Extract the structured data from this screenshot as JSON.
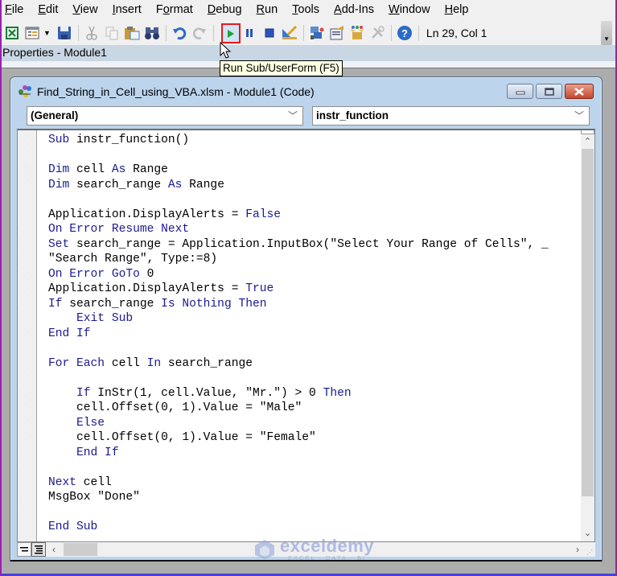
{
  "menu": [
    {
      "label": "File",
      "accel": "F",
      "rest": "ile"
    },
    {
      "label": "Edit",
      "accel": "E",
      "rest": "dit"
    },
    {
      "label": "View",
      "accel": "V",
      "rest": "iew"
    },
    {
      "label": "Insert",
      "accel": "I",
      "rest": "nsert"
    },
    {
      "label": "Format",
      "pre": "F",
      "accel": "o",
      "rest": "rmat"
    },
    {
      "label": "Debug",
      "accel": "D",
      "rest": "ebug"
    },
    {
      "label": "Run",
      "accel": "R",
      "rest": "un"
    },
    {
      "label": "Tools",
      "accel": "T",
      "rest": "ools"
    },
    {
      "label": "Add-Ins",
      "accel": "A",
      "rest": "dd-Ins"
    },
    {
      "label": "Window",
      "accel": "W",
      "rest": "indow"
    },
    {
      "label": "Help",
      "accel": "H",
      "rest": "elp"
    }
  ],
  "toolbar": {
    "status": "Ln 29, Col 1",
    "tooltip": "Run Sub/UserForm (F5)",
    "highlight_color": "#e41b1b"
  },
  "properties_title": "Properties - Module1",
  "code_window": {
    "title": "Find_String_in_Cell_using_VBA.xlsm - Module1 (Code)",
    "object_combo": "(General)",
    "procedure_combo": "instr_function",
    "keyword_color": "#1a1a8e",
    "lines": [
      [
        {
          "t": "Sub",
          "k": 1
        },
        {
          "t": " instr_function()"
        }
      ],
      [],
      [
        {
          "t": "Dim",
          "k": 1
        },
        {
          "t": " cell "
        },
        {
          "t": "As",
          "k": 1
        },
        {
          "t": " Range"
        }
      ],
      [
        {
          "t": "Dim",
          "k": 1
        },
        {
          "t": " search_range "
        },
        {
          "t": "As",
          "k": 1
        },
        {
          "t": " Range"
        }
      ],
      [],
      [
        {
          "t": "Application.DisplayAlerts = "
        },
        {
          "t": "False",
          "k": 1
        }
      ],
      [
        {
          "t": "On Error Resume Next",
          "k": 1
        }
      ],
      [
        {
          "t": "Set",
          "k": 1
        },
        {
          "t": " search_range = Application.InputBox(\"Select Your Range of Cells\", _"
        }
      ],
      [
        {
          "t": "\"Search Range\", Type:=8)"
        }
      ],
      [
        {
          "t": "On Error GoTo",
          "k": 1
        },
        {
          "t": " 0"
        }
      ],
      [
        {
          "t": "Application.DisplayAlerts = "
        },
        {
          "t": "True",
          "k": 1
        }
      ],
      [
        {
          "t": "If",
          "k": 1
        },
        {
          "t": " search_range "
        },
        {
          "t": "Is Nothing Then",
          "k": 1
        }
      ],
      [
        {
          "t": "    "
        },
        {
          "t": "Exit Sub",
          "k": 1
        }
      ],
      [
        {
          "t": "End If",
          "k": 1
        }
      ],
      [],
      [
        {
          "t": "For Each",
          "k": 1
        },
        {
          "t": " cell "
        },
        {
          "t": "In",
          "k": 1
        },
        {
          "t": " search_range"
        }
      ],
      [],
      [
        {
          "t": "    "
        },
        {
          "t": "If",
          "k": 1
        },
        {
          "t": " InStr(1, cell.Value, \"Mr.\") > 0 "
        },
        {
          "t": "Then",
          "k": 1
        }
      ],
      [
        {
          "t": "    cell.Offset(0, 1).Value = \"Male\""
        }
      ],
      [
        {
          "t": "    "
        },
        {
          "t": "Else",
          "k": 1
        }
      ],
      [
        {
          "t": "    cell.Offset(0, 1).Value = \"Female\""
        }
      ],
      [
        {
          "t": "    "
        },
        {
          "t": "End If",
          "k": 1
        }
      ],
      [],
      [
        {
          "t": "Next",
          "k": 1
        },
        {
          "t": " cell"
        }
      ],
      [
        {
          "t": "MsgBox \"Done\""
        }
      ],
      [],
      [
        {
          "t": "End Sub",
          "k": 1
        }
      ]
    ]
  },
  "watermark": {
    "brand": "exceldemy",
    "tagline": "EXCEL · DATA · BI"
  }
}
